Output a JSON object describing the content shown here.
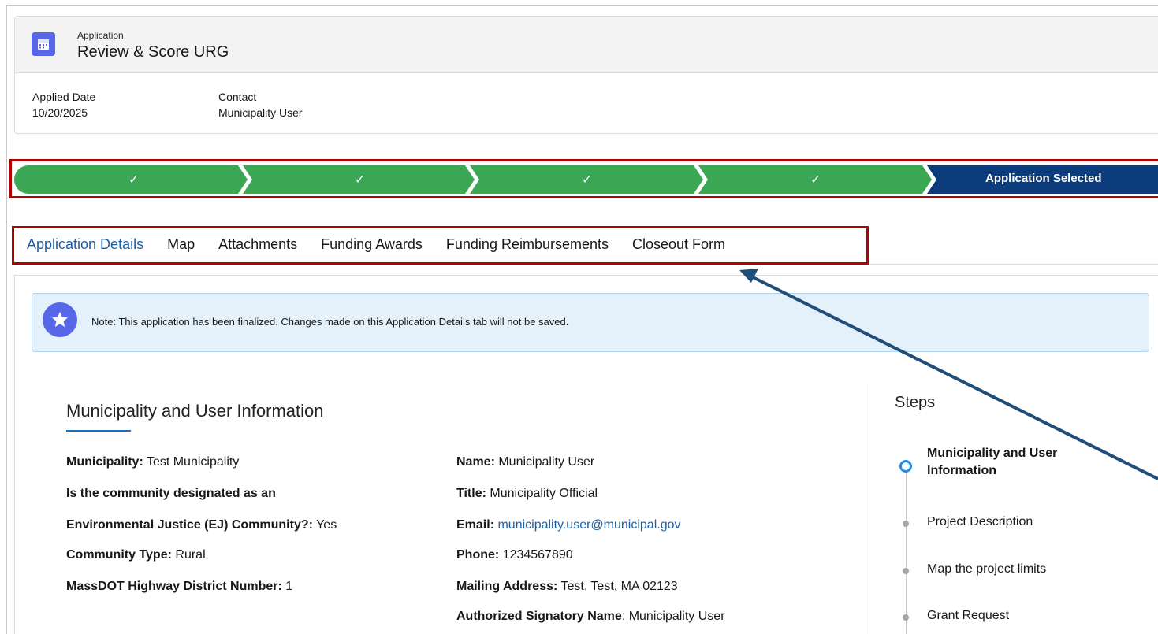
{
  "header": {
    "object_label": "Application",
    "title": "Review & Score URG",
    "fields": [
      {
        "label": "Applied Date",
        "value": "10/20/2025"
      },
      {
        "label": "Contact",
        "value": "Municipality User"
      }
    ]
  },
  "path": {
    "completed_check": "✓",
    "current_stage": "Application Selected",
    "colors": {
      "complete": "#3ba755",
      "current": "#0b3d7d"
    }
  },
  "tabs": [
    "Application Details",
    "Map",
    "Attachments",
    "Funding Awards",
    "Funding Reimbursements",
    "Closeout Form"
  ],
  "note": {
    "icon": "star-icon",
    "text": "Note: This application has been finalized. Changes made on this Application Details tab will not be saved."
  },
  "section": {
    "title": "Municipality and User Information",
    "left": [
      {
        "label": "Municipality:",
        "value": " Test Municipality"
      },
      {
        "label": "Is the community designated as an",
        "value": ""
      },
      {
        "label": "Environmental Justice (EJ) Community?:",
        "value": " Yes"
      },
      {
        "label": "Community Type:",
        "value": " Rural"
      },
      {
        "label": "MassDOT Highway District Number:",
        "value": " 1"
      }
    ],
    "right": [
      {
        "label": "Name:",
        "value": " Municipality User"
      },
      {
        "label": "Title:",
        "value": " Municipality Official"
      },
      {
        "label": "Email:",
        "value": " municipality.user@municipal.gov"
      },
      {
        "label": "Phone:",
        "value": " 1234567890"
      },
      {
        "label": "Mailing Address:",
        "value": " Test, Test, MA 02123"
      },
      {
        "label": "Authorized Signatory Name",
        "value": ": Municipality User"
      }
    ]
  },
  "steps": {
    "title": "Steps",
    "items": [
      {
        "line1": "Municipality and User",
        "line2": "Information"
      },
      {
        "line1": "Project Description"
      },
      {
        "line1": "Map the project limits"
      },
      {
        "line1": "Grant Request"
      }
    ]
  },
  "annotation": {
    "arrow_color": "#1f4e79",
    "box_color": "#b30000"
  }
}
